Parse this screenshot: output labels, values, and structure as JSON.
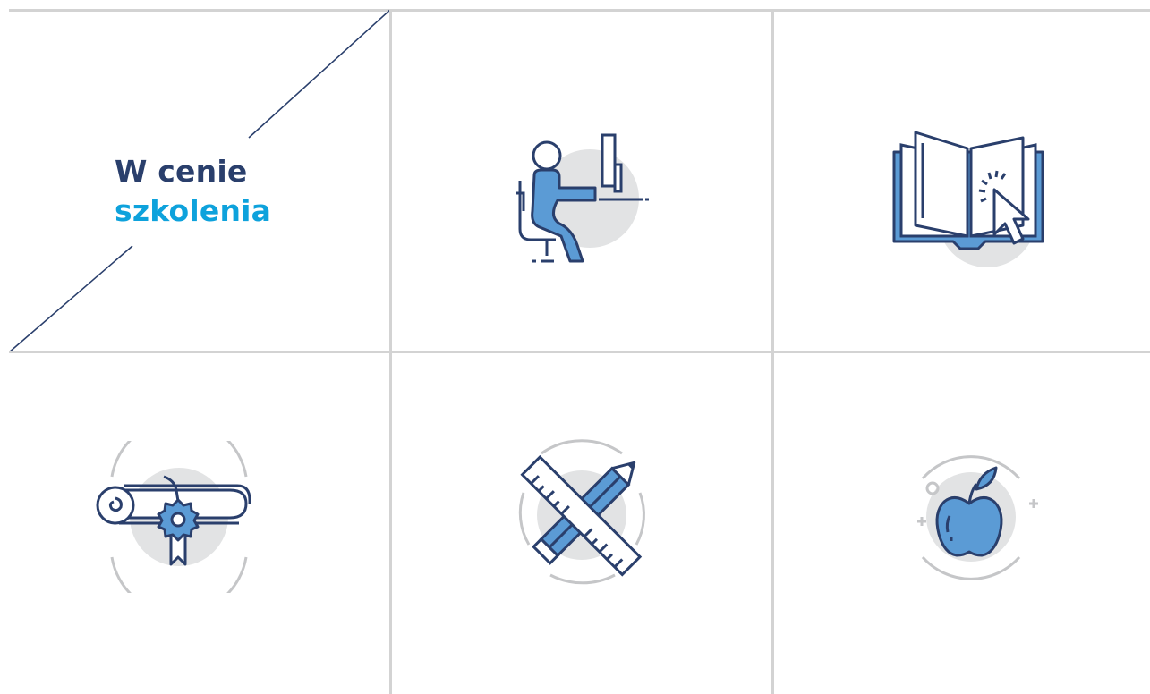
{
  "colors": {
    "navy": "#2a3f6c",
    "accent": "#0ea2dc",
    "icon_fill": "#5b9bd5",
    "circle": "#e2e3e4",
    "ring": "#c5c6c8",
    "grid_line": "#d3d3d3"
  },
  "heading": {
    "line1": "W cenie",
    "line2": "szkolenia"
  },
  "icons": [
    {
      "name": "person-at-computer-icon"
    },
    {
      "name": "open-book-cursor-icon"
    },
    {
      "name": "diploma-scroll-icon"
    },
    {
      "name": "pencil-ruler-icon"
    },
    {
      "name": "apple-icon"
    }
  ]
}
